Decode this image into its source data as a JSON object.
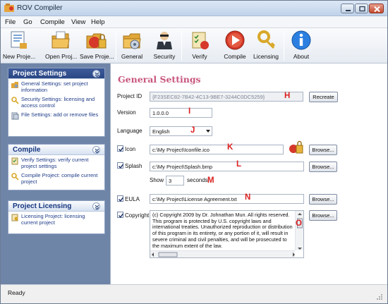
{
  "window": {
    "title": "ROV Compiler"
  },
  "menu": [
    "File",
    "Go",
    "Compile",
    "View",
    "Help"
  ],
  "toolbar": {
    "new_project": "New Proje...",
    "open_project": "Open Proj...",
    "save_project": "Save Proje...",
    "general": "General",
    "security": "Security",
    "verify": "Verify",
    "compile": "Compile",
    "licensing": "Licensing",
    "about": "About"
  },
  "sidebar": {
    "project_settings": {
      "title": "Project Settings",
      "items": [
        "General Settings: set project information",
        "Security Settings: licensing and access control",
        "File Settings: add or remove files"
      ]
    },
    "compile": {
      "title": "Compile",
      "items": [
        "Verify Settings: verify current project settings",
        "Compile Project: compile current project"
      ]
    },
    "licensing": {
      "title": "Project Licensing",
      "items": [
        "Licensing Project: licensing current project"
      ]
    }
  },
  "general": {
    "heading": "General Settings",
    "project_id_label": "Project ID",
    "project_id_value": "{F23SEC82-7B42-4C13-9BE7-3244C0DC5259}",
    "recreate_button": "Recreate",
    "version_label": "Version",
    "version_value": "1.0.0.0",
    "language_label": "Language",
    "language_value": "English",
    "icon_label": "Icon",
    "icon_path": "c:\\My Project\\Iconfile.ico",
    "splash_label": "Splash",
    "splash_path": "c:\\My Project\\Splash.bmp",
    "show_label": "Show",
    "show_value": "3",
    "seconds_label": "seconds",
    "eula_label": "EULA",
    "eula_path": "c:\\My Project\\License Agreement.txt",
    "copyright_label": "Copyright",
    "copyright_text": "(c) Copyright 2009 by Dr. Johnathan Mun. All rights reserved. This program is protected by U.S. copyright laws and international treaties. Unauthorized reproduction or distribution of this program in its entirety, or any portion of it, will result in severe criminal and civil penalties, and will be prosecuted to the maximum extent of the law.",
    "browse_label": "Browse..."
  },
  "markers": {
    "h": "H",
    "i": "I",
    "j": "J",
    "k": "K",
    "l": "L",
    "m": "M",
    "n": "N",
    "o": "O"
  },
  "status": {
    "text": "Ready"
  },
  "colors": {
    "heading": "#c8567f",
    "marker": "#dc1f1f",
    "sidebar_bg": "#6f85a8"
  }
}
